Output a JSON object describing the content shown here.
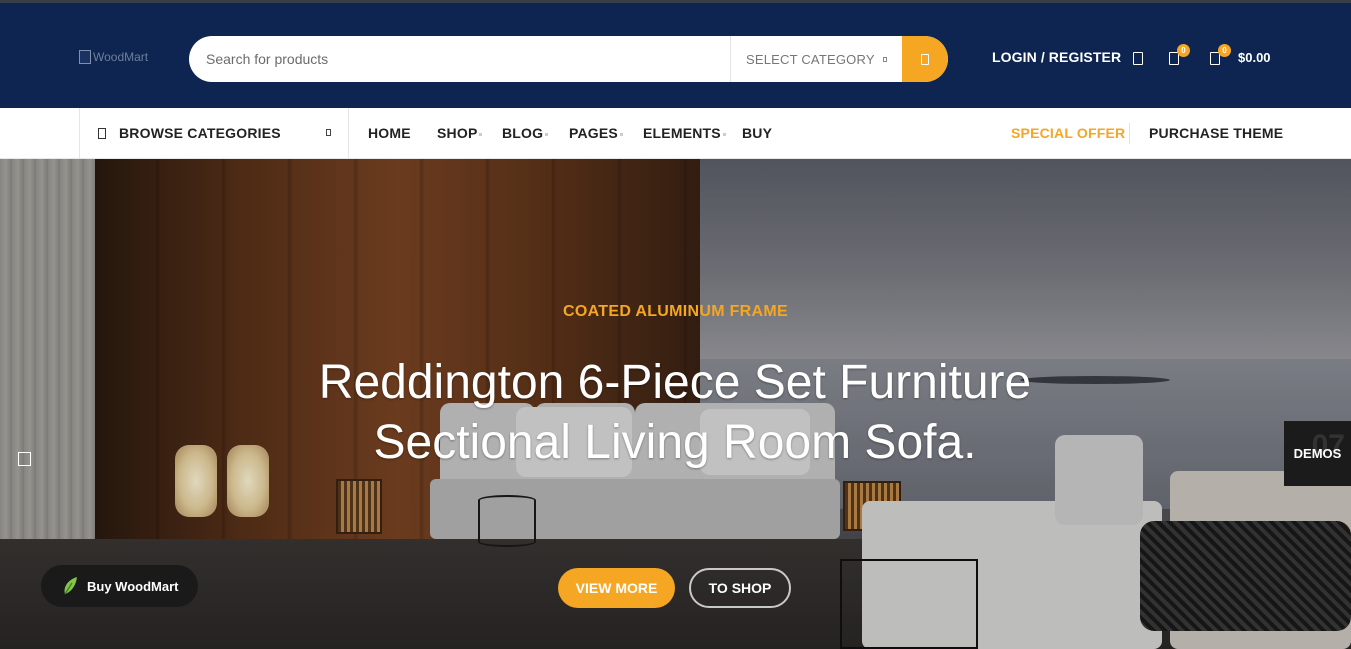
{
  "header": {
    "logo_alt": "WoodMart",
    "search": {
      "placeholder": "Search for products"
    },
    "category_select": {
      "label": "SELECT CATEGORY"
    },
    "login_label": "LOGIN / REGISTER",
    "wishlist_count": "0",
    "cart_count": "0",
    "cart_total": "$0.00"
  },
  "nav": {
    "browse_label": "BROWSE CATEGORIES",
    "items": [
      {
        "label": "HOME"
      },
      {
        "label": "SHOP"
      },
      {
        "label": "BLOG"
      },
      {
        "label": "PAGES"
      },
      {
        "label": "ELEMENTS"
      },
      {
        "label": "BUY"
      }
    ],
    "special_offer": "SPECIAL OFFER",
    "purchase_theme": "PURCHASE THEME"
  },
  "hero": {
    "eyebrow": "COATED ALUMINUM FRAME",
    "title": "Reddington 6-Piece Set Furniture Sectional Living Room Sofa.",
    "primary_button": "VIEW MORE",
    "secondary_button": "TO SHOP"
  },
  "demos": {
    "label": "DEMOS",
    "ghost": "07"
  },
  "buy_pill": {
    "label": "Buy WoodMart"
  },
  "colors": {
    "header_bg": "#0d2550",
    "accent": "#f5a623",
    "text_dark": "#222222"
  },
  "icons": [
    "search-icon",
    "user-icon",
    "heart-icon",
    "compare-icon",
    "cart-icon",
    "menu-icon",
    "chevron-down-icon",
    "arrow-left-icon",
    "leaf-icon"
  ]
}
